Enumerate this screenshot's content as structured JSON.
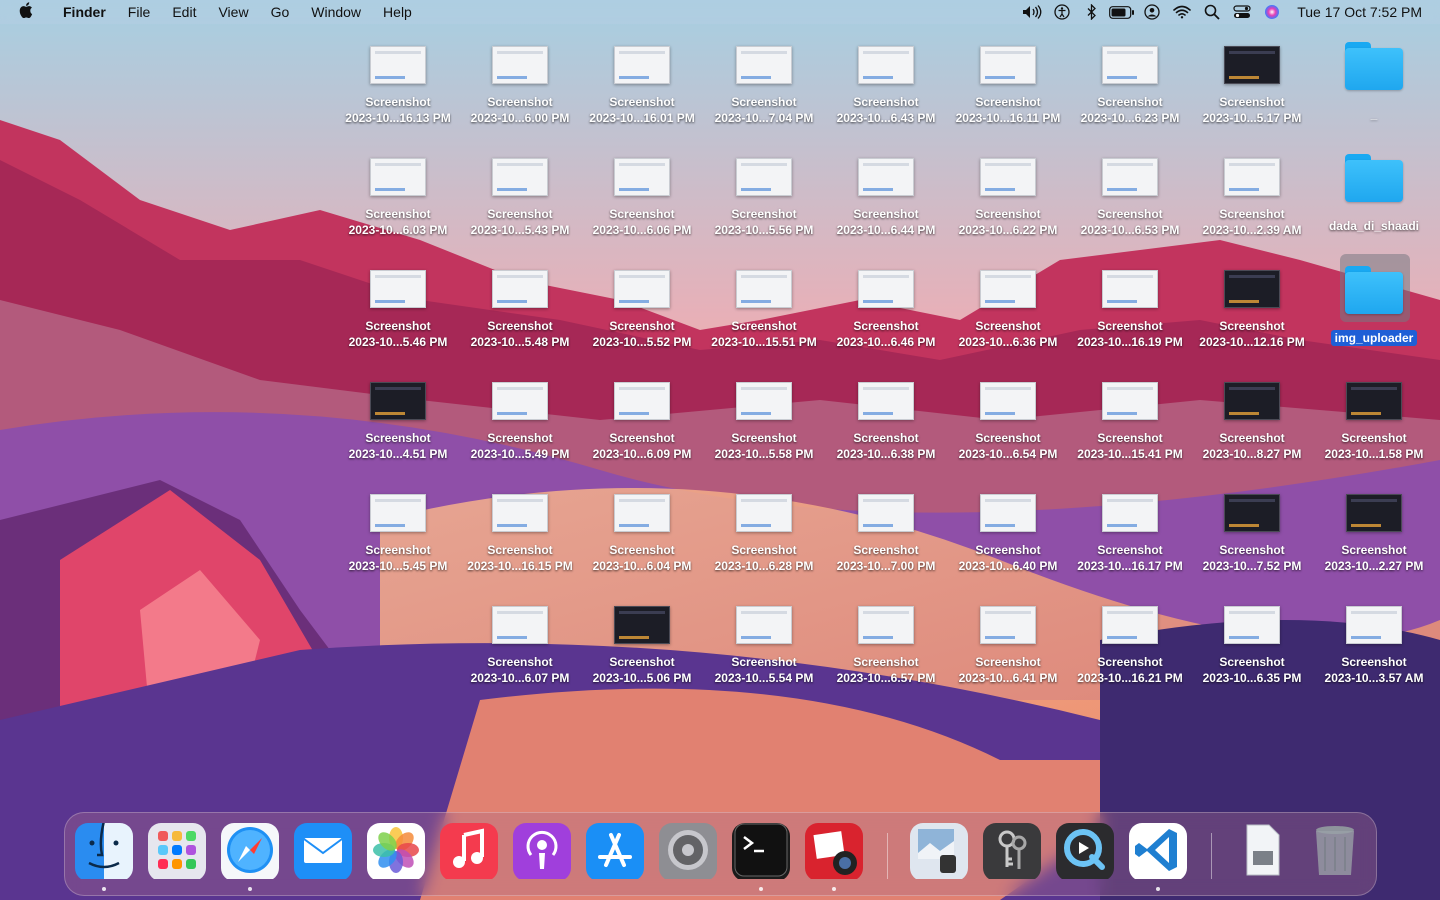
{
  "menubar": {
    "app_name": "Finder",
    "menus": [
      "File",
      "Edit",
      "View",
      "Go",
      "Window",
      "Help"
    ],
    "status_icons": [
      "volume-icon",
      "accessibility-icon",
      "bluetooth-icon",
      "battery-icon",
      "user-icon",
      "wifi-icon",
      "search-icon",
      "control-center-icon",
      "siri-icon"
    ],
    "clock": "Tue 17 Oct  7:52 PM"
  },
  "desktop": {
    "rows": [
      [
        {
          "type": "screenshot",
          "name": "Screenshot",
          "date": "2023-10...16.13 PM"
        },
        {
          "type": "screenshot",
          "name": "Screenshot",
          "date": "2023-10...6.00 PM"
        },
        {
          "type": "screenshot",
          "name": "Screenshot",
          "date": "2023-10...16.01 PM"
        },
        {
          "type": "screenshot",
          "name": "Screenshot",
          "date": "2023-10...7.04 PM"
        },
        {
          "type": "screenshot",
          "name": "Screenshot",
          "date": "2023-10...6.43 PM"
        },
        {
          "type": "screenshot",
          "name": "Screenshot",
          "date": "2023-10...16.11 PM"
        },
        {
          "type": "screenshot",
          "name": "Screenshot",
          "date": "2023-10...6.23 PM"
        },
        {
          "type": "screenshot-dark",
          "name": "Screenshot",
          "date": "2023-10...5.17 PM"
        },
        {
          "type": "folder",
          "name": "_",
          "date": ""
        }
      ],
      [
        {
          "type": "screenshot",
          "name": "Screenshot",
          "date": "2023-10...6.03 PM"
        },
        {
          "type": "screenshot",
          "name": "Screenshot",
          "date": "2023-10...5.43 PM"
        },
        {
          "type": "screenshot",
          "name": "Screenshot",
          "date": "2023-10...6.06 PM"
        },
        {
          "type": "screenshot",
          "name": "Screenshot",
          "date": "2023-10...5.56 PM"
        },
        {
          "type": "screenshot",
          "name": "Screenshot",
          "date": "2023-10...6.44 PM"
        },
        {
          "type": "screenshot",
          "name": "Screenshot",
          "date": "2023-10...6.22 PM"
        },
        {
          "type": "screenshot",
          "name": "Screenshot",
          "date": "2023-10...6.53 PM"
        },
        {
          "type": "screenshot",
          "name": "Screenshot",
          "date": "2023-10...2.39 AM"
        },
        {
          "type": "folder",
          "name": "dada_di_shaadi",
          "date": ""
        }
      ],
      [
        {
          "type": "screenshot",
          "name": "Screenshot",
          "date": "2023-10...5.46 PM"
        },
        {
          "type": "screenshot",
          "name": "Screenshot",
          "date": "2023-10...5.48 PM"
        },
        {
          "type": "screenshot",
          "name": "Screenshot",
          "date": "2023-10...5.52 PM"
        },
        {
          "type": "screenshot",
          "name": "Screenshot",
          "date": "2023-10...15.51 PM"
        },
        {
          "type": "screenshot",
          "name": "Screenshot",
          "date": "2023-10...6.46 PM"
        },
        {
          "type": "screenshot",
          "name": "Screenshot",
          "date": "2023-10...6.36 PM"
        },
        {
          "type": "screenshot",
          "name": "Screenshot",
          "date": "2023-10...16.19 PM"
        },
        {
          "type": "screenshot-dark",
          "name": "Screenshot",
          "date": "2023-10...12.16 PM"
        },
        {
          "type": "folder-selected",
          "name": "img_uploader",
          "date": ""
        }
      ],
      [
        {
          "type": "screenshot-dark",
          "name": "Screenshot",
          "date": "2023-10...4.51 PM"
        },
        {
          "type": "screenshot",
          "name": "Screenshot",
          "date": "2023-10...5.49 PM"
        },
        {
          "type": "screenshot",
          "name": "Screenshot",
          "date": "2023-10...6.09 PM"
        },
        {
          "type": "screenshot",
          "name": "Screenshot",
          "date": "2023-10...5.58 PM"
        },
        {
          "type": "screenshot",
          "name": "Screenshot",
          "date": "2023-10...6.38 PM"
        },
        {
          "type": "screenshot",
          "name": "Screenshot",
          "date": "2023-10...6.54 PM"
        },
        {
          "type": "screenshot",
          "name": "Screenshot",
          "date": "2023-10...15.41 PM"
        },
        {
          "type": "screenshot-dark",
          "name": "Screenshot",
          "date": "2023-10...8.27 PM"
        },
        {
          "type": "screenshot-dark",
          "name": "Screenshot",
          "date": "2023-10...1.58 PM"
        }
      ],
      [
        {
          "type": "screenshot",
          "name": "Screenshot",
          "date": "2023-10...5.45 PM"
        },
        {
          "type": "screenshot",
          "name": "Screenshot",
          "date": "2023-10...16.15 PM"
        },
        {
          "type": "screenshot",
          "name": "Screenshot",
          "date": "2023-10...6.04 PM"
        },
        {
          "type": "screenshot",
          "name": "Screenshot",
          "date": "2023-10...6.28 PM"
        },
        {
          "type": "screenshot",
          "name": "Screenshot",
          "date": "2023-10...7.00 PM"
        },
        {
          "type": "screenshot",
          "name": "Screenshot",
          "date": "2023-10...6.40 PM"
        },
        {
          "type": "screenshot",
          "name": "Screenshot",
          "date": "2023-10...16.17 PM"
        },
        {
          "type": "screenshot-dark",
          "name": "Screenshot",
          "date": "2023-10...7.52 PM"
        },
        {
          "type": "screenshot-dark",
          "name": "Screenshot",
          "date": "2023-10...2.27 PM"
        }
      ],
      [
        null,
        {
          "type": "screenshot",
          "name": "Screenshot",
          "date": "2023-10...6.07 PM"
        },
        {
          "type": "screenshot-dark",
          "name": "Screenshot",
          "date": "2023-10...5.06 PM"
        },
        {
          "type": "screenshot",
          "name": "Screenshot",
          "date": "2023-10...5.54 PM"
        },
        {
          "type": "screenshot",
          "name": "Screenshot",
          "date": "2023-10...6.57 PM"
        },
        {
          "type": "screenshot",
          "name": "Screenshot",
          "date": "2023-10...6.41 PM"
        },
        {
          "type": "screenshot",
          "name": "Screenshot",
          "date": "2023-10...16.21 PM"
        },
        {
          "type": "screenshot",
          "name": "Screenshot",
          "date": "2023-10...6.35 PM"
        },
        {
          "type": "screenshot",
          "name": "Screenshot",
          "date": "2023-10...3.57 AM"
        }
      ]
    ]
  },
  "dock": {
    "items": [
      {
        "name": "finder",
        "icon": "finder-icon",
        "color": "#2a8cf0",
        "running": true
      },
      {
        "name": "launchpad",
        "icon": "launchpad-icon",
        "color": "#e6e6ee",
        "running": false
      },
      {
        "name": "safari",
        "icon": "safari-icon",
        "color": "#e9f1fb",
        "running": true
      },
      {
        "name": "mail",
        "icon": "mail-icon",
        "color": "#1e8ff7",
        "running": false
      },
      {
        "name": "photos",
        "icon": "photos-icon",
        "color": "#ffffff",
        "running": false
      },
      {
        "name": "music",
        "icon": "music-icon",
        "color": "#f43b4e",
        "running": false
      },
      {
        "name": "podcasts",
        "icon": "podcasts-icon",
        "color": "#a03fdc",
        "running": false
      },
      {
        "name": "app-store",
        "icon": "app-store-icon",
        "color": "#1a8ff6",
        "running": false
      },
      {
        "name": "system-preferences",
        "icon": "gear-icon",
        "color": "#8e8e93",
        "running": false
      },
      {
        "name": "terminal",
        "icon": "terminal-icon",
        "color": "#1b1b1b",
        "running": true
      },
      {
        "name": "photo-booth",
        "icon": "photo-booth-icon",
        "color": "#d9232e",
        "running": true
      },
      {
        "name": "preview",
        "icon": "preview-icon",
        "color": "#dfe6ef",
        "running": false
      },
      {
        "name": "keychain-access",
        "icon": "keychain-icon",
        "color": "#3a3a3c",
        "running": false
      },
      {
        "name": "quicktime",
        "icon": "quicktime-icon",
        "color": "#2b2b2e",
        "running": false
      },
      {
        "name": "vscode",
        "icon": "vscode-icon",
        "color": "#ffffff",
        "running": true
      },
      {
        "name": "downloads-stack",
        "icon": "document-stack-icon",
        "color": "#e8ebef",
        "running": false
      },
      {
        "name": "trash",
        "icon": "trash-icon",
        "color": "#9aa0a8",
        "running": false
      }
    ]
  }
}
